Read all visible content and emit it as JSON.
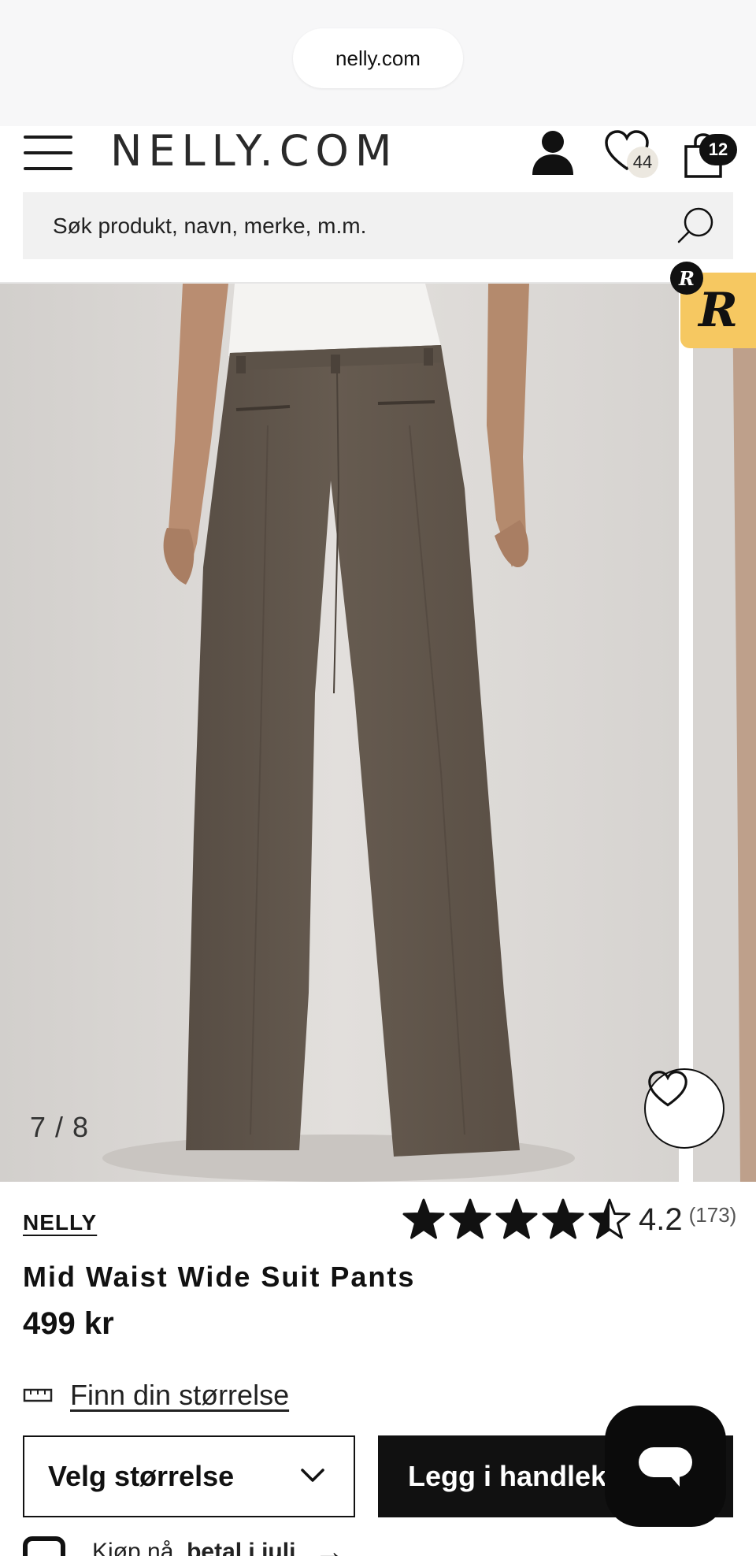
{
  "browser": {
    "url": "nelly.com"
  },
  "header": {
    "logo": "NELLY.COM",
    "wishlist_count": "44",
    "bag_count": "12",
    "search_placeholder": "Søk produkt, navn, merke, m.m."
  },
  "gallery": {
    "counter": "7 / 8"
  },
  "product": {
    "brand": "NELLY",
    "rating": {
      "value": "4.2",
      "count": "(173)",
      "stars": 4.5
    },
    "title": "Mid Waist Wide Suit Pants",
    "price": "499 kr",
    "size_guide": "Finn din størrelse",
    "size_select": "Velg størrelse",
    "add_to_cart": "Legg i handlekurv"
  },
  "klarna": {
    "prefix": "Kjøp nå, ",
    "bold": "betal i juli"
  },
  "colors": {
    "accent": "#111111",
    "badge_yellow": "#f6c861",
    "pants": "#5f554b"
  }
}
